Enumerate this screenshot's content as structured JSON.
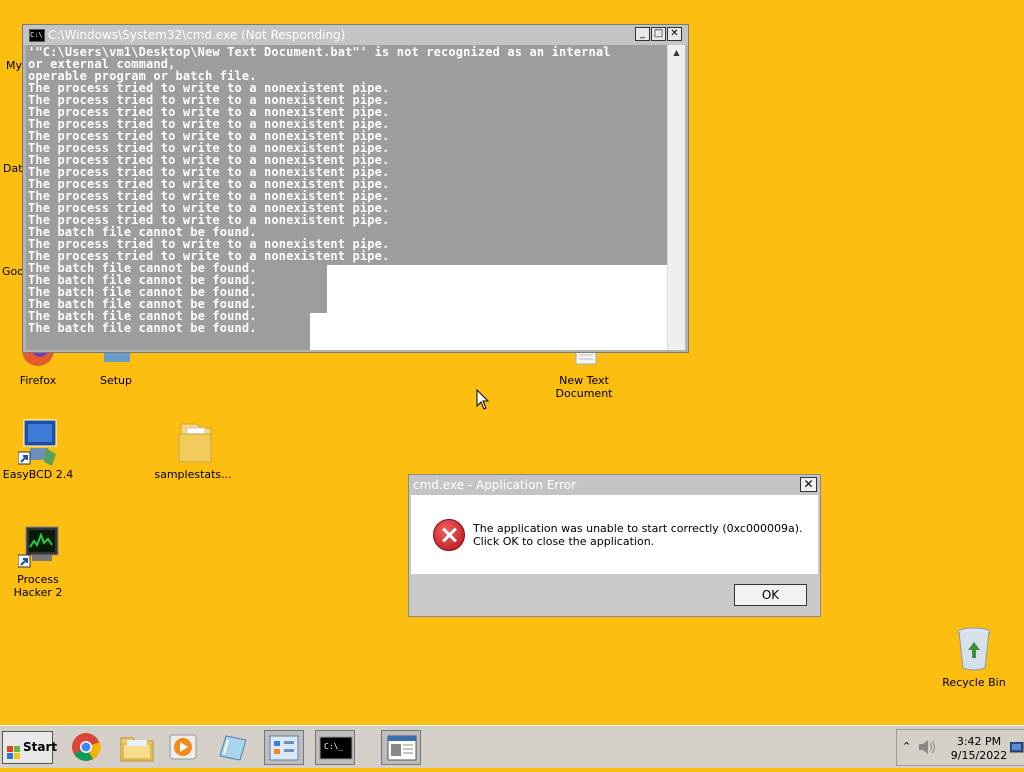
{
  "desktop": {
    "partial_labels": [
      "My",
      "Data",
      "Goo"
    ],
    "icons": [
      {
        "label": "Firefox"
      },
      {
        "label": "Setup"
      },
      {
        "label": "New Text Document"
      },
      {
        "label": "EasyBCD 2.4"
      },
      {
        "label": "samplestats..."
      },
      {
        "label": "Process Hacker 2"
      },
      {
        "label": "Recycle Bin"
      }
    ]
  },
  "cmd_window": {
    "title": "C:\\Windows\\System32\\cmd.exe (Not Responding)",
    "icon_text": "C:\\",
    "minimize": "_",
    "maximize": "□",
    "close": "✕",
    "lines": [
      "'\"C:\\Users\\vm1\\Desktop\\New Text Document.bat\"' is not recognized as an internal",
      "or external command,",
      "operable program or batch file.",
      "The process tried to write to a nonexistent pipe.",
      "The process tried to write to a nonexistent pipe.",
      "The process tried to write to a nonexistent pipe.",
      "The process tried to write to a nonexistent pipe.",
      "The process tried to write to a nonexistent pipe.",
      "The process tried to write to a nonexistent pipe.",
      "The process tried to write to a nonexistent pipe.",
      "The process tried to write to a nonexistent pipe.",
      "The process tried to write to a nonexistent pipe.",
      "The process tried to write to a nonexistent pipe.",
      "The process tried to write to a nonexistent pipe.",
      "The process tried to write to a nonexistent pipe.",
      "The batch file cannot be found.",
      "The process tried to write to a nonexistent pipe.",
      "The process tried to write to a nonexistent pipe.",
      "The batch file cannot be found.",
      "The batch file cannot be found.",
      "The batch file cannot be found.",
      "The batch file cannot be found.",
      "The batch file cannot be found.",
      "The batch file cannot be found."
    ]
  },
  "error_dialog": {
    "title": "cmd.exe - Application Error",
    "message": "The application was unable to start correctly (0xc000009a). Click OK to close the application.",
    "ok_label": "OK",
    "close": "✕"
  },
  "taskbar": {
    "start_label": "Start",
    "apps": [
      "chrome-icon",
      "file-explorer-icon",
      "media-player-icon",
      "notepad-icon",
      "control-panel-icon",
      "cmd-icon",
      "document-viewer-icon"
    ],
    "tray": {
      "chevron": "⌃",
      "time": "3:42 PM",
      "date": "9/15/2022"
    }
  },
  "colors": {
    "desktop": "#FDBE12",
    "console_selection": "#9D9D9D",
    "error_red": "#C8161E"
  }
}
